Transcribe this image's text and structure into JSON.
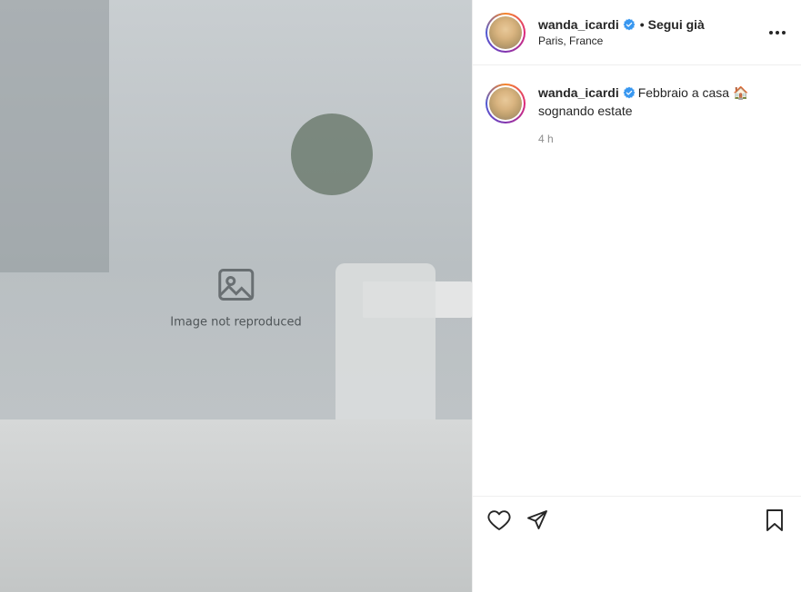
{
  "media": {
    "placeholder_label": "Image not reproduced"
  },
  "header": {
    "username": "wanda_icardi",
    "separator": "•",
    "follow_label": "Segui già",
    "location": "Paris, France"
  },
  "caption": {
    "username": "wanda_icardi",
    "text": "Febbraio a casa 🏠 sognando estate",
    "time": "4 h"
  },
  "icons": {
    "verified": "verified-badge-icon",
    "more": "more-options-icon",
    "like": "heart-icon",
    "share": "send-icon",
    "save": "bookmark-icon"
  },
  "colors": {
    "verified_blue": "#3897f0",
    "text": "#262626",
    "muted": "#8e8e8e",
    "divider": "#efefef"
  }
}
